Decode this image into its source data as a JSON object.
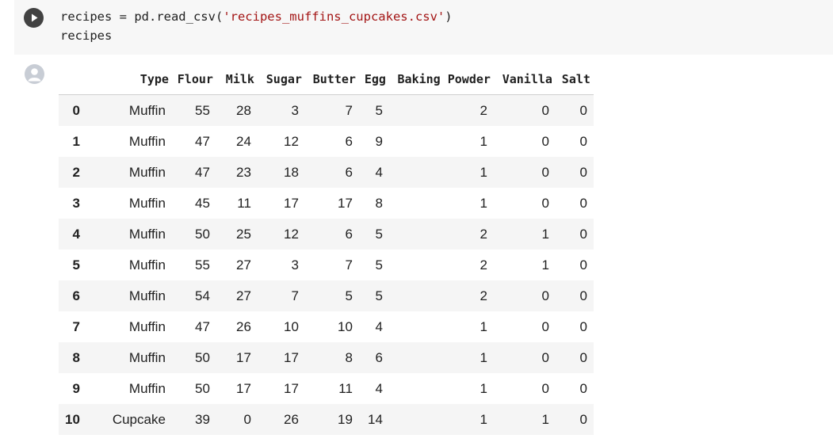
{
  "code_cell": {
    "line1_prefix": "recipes = pd.read_csv(",
    "line1_string": "'recipes_muffins_cupcakes.csv'",
    "line1_suffix": ")",
    "line2": "recipes"
  },
  "icons": {
    "run": "play-icon",
    "output": "user-avatar-icon"
  },
  "colors": {
    "string_literal": "#a31515",
    "run_button": "#424242"
  },
  "table": {
    "columns": [
      "",
      "Type",
      "Flour",
      "Milk",
      "Sugar",
      "Butter",
      "Egg",
      "Baking Powder",
      "Vanilla",
      "Salt"
    ],
    "rows": [
      [
        "0",
        "Muffin",
        "55",
        "28",
        "3",
        "7",
        "5",
        "2",
        "0",
        "0"
      ],
      [
        "1",
        "Muffin",
        "47",
        "24",
        "12",
        "6",
        "9",
        "1",
        "0",
        "0"
      ],
      [
        "2",
        "Muffin",
        "47",
        "23",
        "18",
        "6",
        "4",
        "1",
        "0",
        "0"
      ],
      [
        "3",
        "Muffin",
        "45",
        "11",
        "17",
        "17",
        "8",
        "1",
        "0",
        "0"
      ],
      [
        "4",
        "Muffin",
        "50",
        "25",
        "12",
        "6",
        "5",
        "2",
        "1",
        "0"
      ],
      [
        "5",
        "Muffin",
        "55",
        "27",
        "3",
        "7",
        "5",
        "2",
        "1",
        "0"
      ],
      [
        "6",
        "Muffin",
        "54",
        "27",
        "7",
        "5",
        "5",
        "2",
        "0",
        "0"
      ],
      [
        "7",
        "Muffin",
        "47",
        "26",
        "10",
        "10",
        "4",
        "1",
        "0",
        "0"
      ],
      [
        "8",
        "Muffin",
        "50",
        "17",
        "17",
        "8",
        "6",
        "1",
        "0",
        "0"
      ],
      [
        "9",
        "Muffin",
        "50",
        "17",
        "17",
        "11",
        "4",
        "1",
        "0",
        "0"
      ],
      [
        "10",
        "Cupcake",
        "39",
        "0",
        "26",
        "19",
        "14",
        "1",
        "1",
        "0"
      ]
    ]
  }
}
